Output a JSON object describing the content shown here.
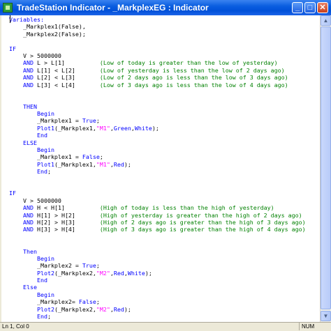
{
  "window": {
    "title": "TradeStation Indicator - _MarkplexEG : Indicator",
    "minimize_glyph": "_",
    "maximize_glyph": "□",
    "close_glyph": "✕",
    "icon": "tradestation-app-icon"
  },
  "editor": {
    "lines": [
      [
        {
          "t": "Variables:",
          "c": "kw"
        }
      ],
      [
        {
          "t": "    _Markplex1(False),",
          "c": ""
        }
      ],
      [
        {
          "t": "    _Markplex2(False);",
          "c": ""
        }
      ],
      [
        {
          "t": "",
          "c": ""
        }
      ],
      [
        {
          "t": "IF",
          "c": "kw"
        }
      ],
      [
        {
          "t": "    V > 5000000",
          "c": ""
        }
      ],
      [
        {
          "t": "    ",
          "c": ""
        },
        {
          "t": "AND",
          "c": "kw"
        },
        {
          "t": " L > L[1]          ",
          "c": ""
        },
        {
          "t": "(Low of today is greater than the low of yesterday)",
          "c": "cm"
        }
      ],
      [
        {
          "t": "    ",
          "c": ""
        },
        {
          "t": "AND",
          "c": "kw"
        },
        {
          "t": " L[1] < L[2]       ",
          "c": ""
        },
        {
          "t": "(Low of yesterday is less than the low of 2 days ago)",
          "c": "cm"
        }
      ],
      [
        {
          "t": "    ",
          "c": ""
        },
        {
          "t": "AND",
          "c": "kw"
        },
        {
          "t": " L[2] < L[3]       ",
          "c": ""
        },
        {
          "t": "(Low of 2 days ago is less than the low of 3 days ago)",
          "c": "cm"
        }
      ],
      [
        {
          "t": "    ",
          "c": ""
        },
        {
          "t": "AND",
          "c": "kw"
        },
        {
          "t": " L[3] < L[4]       ",
          "c": ""
        },
        {
          "t": "(Low of 3 days ago is less than the low of 4 days ago)",
          "c": "cm"
        }
      ],
      [
        {
          "t": "",
          "c": ""
        }
      ],
      [
        {
          "t": "",
          "c": ""
        }
      ],
      [
        {
          "t": "    ",
          "c": ""
        },
        {
          "t": "THEN",
          "c": "kw"
        }
      ],
      [
        {
          "t": "        ",
          "c": ""
        },
        {
          "t": "Begin",
          "c": "kw"
        }
      ],
      [
        {
          "t": "        _Markplex1 = ",
          "c": ""
        },
        {
          "t": "True",
          "c": "kw"
        },
        {
          "t": ";",
          "c": ""
        }
      ],
      [
        {
          "t": "        ",
          "c": ""
        },
        {
          "t": "Plot1",
          "c": "kw"
        },
        {
          "t": "(_Markplex1,",
          "c": ""
        },
        {
          "t": "\"M1\"",
          "c": "str"
        },
        {
          "t": ",",
          "c": ""
        },
        {
          "t": "Green",
          "c": "kw"
        },
        {
          "t": ",",
          "c": ""
        },
        {
          "t": "White",
          "c": "kw"
        },
        {
          "t": ");",
          "c": ""
        }
      ],
      [
        {
          "t": "        ",
          "c": ""
        },
        {
          "t": "End",
          "c": "kw"
        }
      ],
      [
        {
          "t": "    ",
          "c": ""
        },
        {
          "t": "ELSE",
          "c": "kw"
        }
      ],
      [
        {
          "t": "        ",
          "c": ""
        },
        {
          "t": "Begin",
          "c": "kw"
        }
      ],
      [
        {
          "t": "        _Markplex1 = ",
          "c": ""
        },
        {
          "t": "False",
          "c": "kw"
        },
        {
          "t": ";",
          "c": ""
        }
      ],
      [
        {
          "t": "        ",
          "c": ""
        },
        {
          "t": "Plot1",
          "c": "kw"
        },
        {
          "t": "(_Markplex1,",
          "c": ""
        },
        {
          "t": "\"M1\"",
          "c": "str"
        },
        {
          "t": ",",
          "c": ""
        },
        {
          "t": "Red",
          "c": "kw"
        },
        {
          "t": ");",
          "c": ""
        }
      ],
      [
        {
          "t": "        ",
          "c": ""
        },
        {
          "t": "End",
          "c": "kw"
        },
        {
          "t": ";",
          "c": ""
        }
      ],
      [
        {
          "t": "",
          "c": ""
        }
      ],
      [
        {
          "t": "",
          "c": ""
        }
      ],
      [
        {
          "t": "IF",
          "c": "kw"
        }
      ],
      [
        {
          "t": "    V > 5000000",
          "c": ""
        }
      ],
      [
        {
          "t": "    ",
          "c": ""
        },
        {
          "t": "AND",
          "c": "kw"
        },
        {
          "t": " H < H[1]          ",
          "c": ""
        },
        {
          "t": "(High of today is less than the high of yesterday)",
          "c": "cm"
        }
      ],
      [
        {
          "t": "    ",
          "c": ""
        },
        {
          "t": "AND",
          "c": "kw"
        },
        {
          "t": " H[1] > H[2]       ",
          "c": ""
        },
        {
          "t": "(High of yesterday is greater than the high of 2 days ago)",
          "c": "cm"
        }
      ],
      [
        {
          "t": "    ",
          "c": ""
        },
        {
          "t": "AND",
          "c": "kw"
        },
        {
          "t": " H[2] > H[3]       ",
          "c": ""
        },
        {
          "t": "(High of 2 days ago is greater than the high of 3 days ago)",
          "c": "cm"
        }
      ],
      [
        {
          "t": "    ",
          "c": ""
        },
        {
          "t": "AND",
          "c": "kw"
        },
        {
          "t": " H[3] > H[4]       ",
          "c": ""
        },
        {
          "t": "(High of 3 days ago is greater than the high of 4 days ago)",
          "c": "cm"
        }
      ],
      [
        {
          "t": "",
          "c": ""
        }
      ],
      [
        {
          "t": "",
          "c": ""
        }
      ],
      [
        {
          "t": "    ",
          "c": ""
        },
        {
          "t": "Then",
          "c": "kw"
        }
      ],
      [
        {
          "t": "        ",
          "c": ""
        },
        {
          "t": "Begin",
          "c": "kw"
        }
      ],
      [
        {
          "t": "        _Markplex2 = ",
          "c": ""
        },
        {
          "t": "True",
          "c": "kw"
        },
        {
          "t": ";",
          "c": ""
        }
      ],
      [
        {
          "t": "        ",
          "c": ""
        },
        {
          "t": "Plot2",
          "c": "kw"
        },
        {
          "t": "(_Markplex2,",
          "c": ""
        },
        {
          "t": "\"M2\"",
          "c": "str"
        },
        {
          "t": ",",
          "c": ""
        },
        {
          "t": "Red",
          "c": "kw"
        },
        {
          "t": ",",
          "c": ""
        },
        {
          "t": "White",
          "c": "kw"
        },
        {
          "t": ");",
          "c": ""
        }
      ],
      [
        {
          "t": "        ",
          "c": ""
        },
        {
          "t": "End",
          "c": "kw"
        }
      ],
      [
        {
          "t": "    ",
          "c": ""
        },
        {
          "t": "Else",
          "c": "kw"
        }
      ],
      [
        {
          "t": "        ",
          "c": ""
        },
        {
          "t": "Begin",
          "c": "kw"
        }
      ],
      [
        {
          "t": "        _Markplex2= ",
          "c": ""
        },
        {
          "t": "False",
          "c": "kw"
        },
        {
          "t": ";",
          "c": ""
        }
      ],
      [
        {
          "t": "        ",
          "c": ""
        },
        {
          "t": "Plot2",
          "c": "kw"
        },
        {
          "t": "(_Markplex2,",
          "c": ""
        },
        {
          "t": "\"M2\"",
          "c": "str"
        },
        {
          "t": ",",
          "c": ""
        },
        {
          "t": "Red",
          "c": "kw"
        },
        {
          "t": ");",
          "c": ""
        }
      ],
      [
        {
          "t": "        ",
          "c": ""
        },
        {
          "t": "End",
          "c": "kw"
        },
        {
          "t": ";",
          "c": ""
        }
      ]
    ]
  },
  "scrollbar": {
    "up_glyph": "▲",
    "down_glyph": "▼"
  },
  "status": {
    "position": "Ln 1, Col 0",
    "num": "NUM"
  },
  "colors": {
    "keyword": "#0000ff",
    "comment": "#008000",
    "string": "#ff00ff",
    "titlebar": "#0a5ee0"
  }
}
